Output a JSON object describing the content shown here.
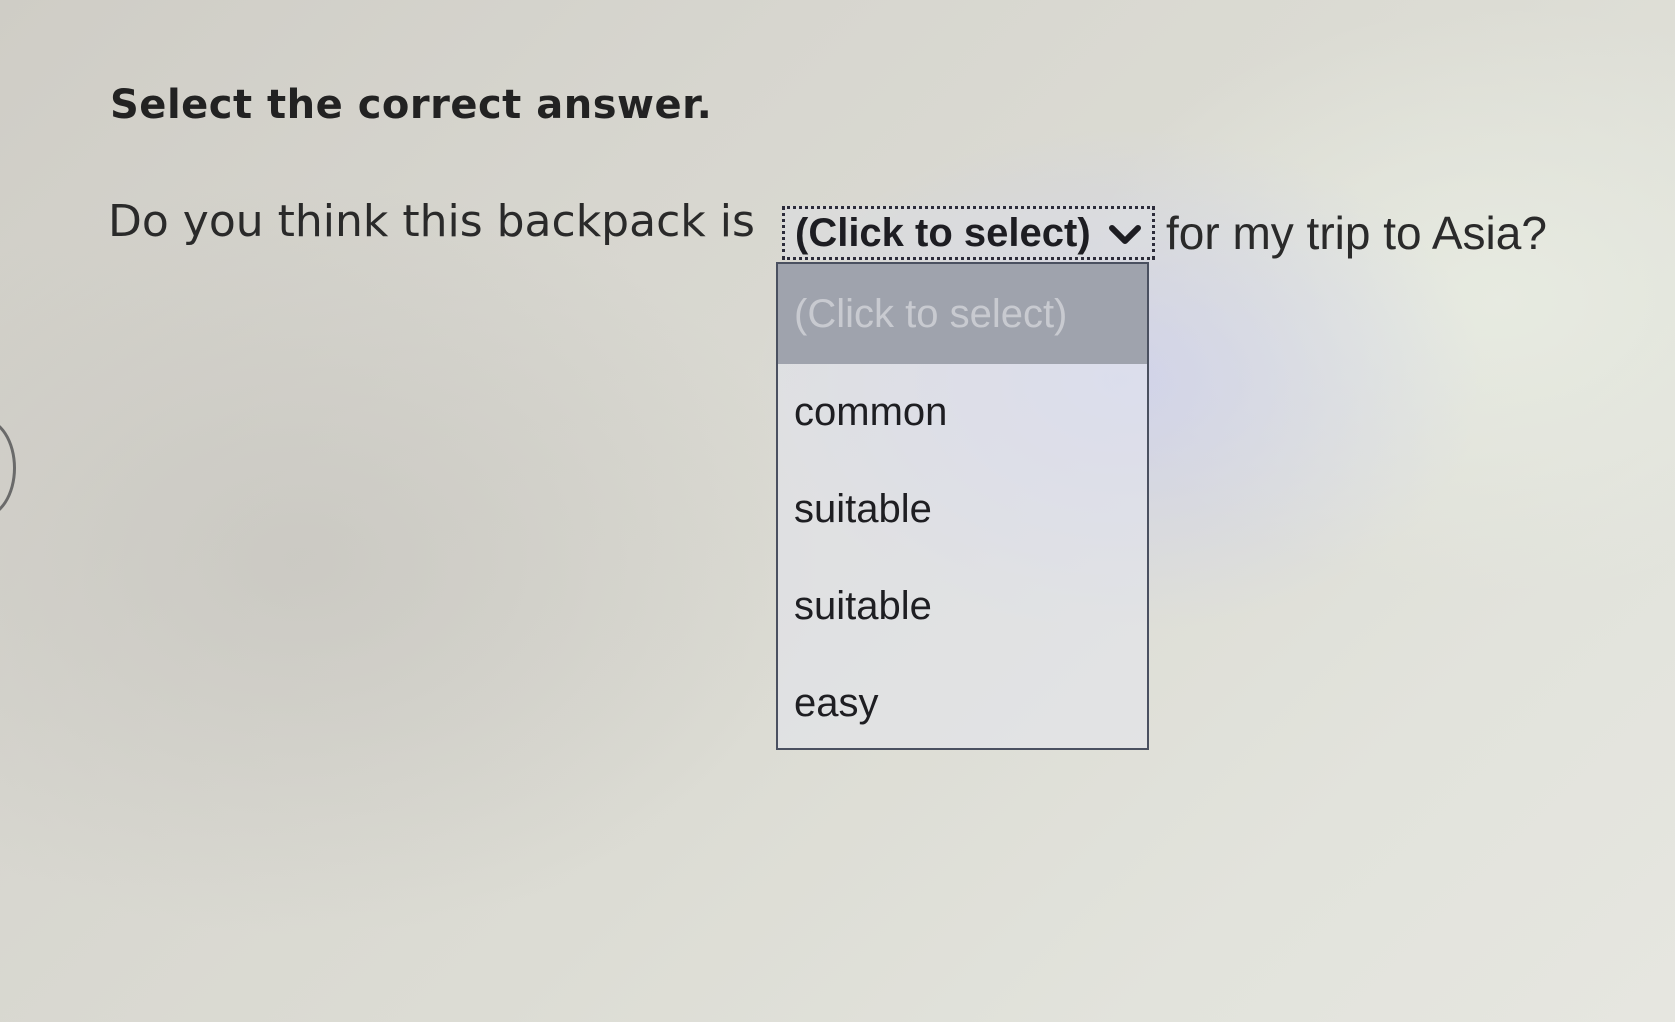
{
  "instruction": "Select the correct answer.",
  "question": {
    "before": "Do you think this backpack is",
    "after": "for my trip to Asia?"
  },
  "select": {
    "selected_label": "(Click to select)",
    "chevron_icon": "chevron-down-icon",
    "options": [
      {
        "label": "(Click to select)",
        "highlighted": true
      },
      {
        "label": "common",
        "highlighted": false
      },
      {
        "label": "suitable",
        "highlighted": false
      },
      {
        "label": "suitable",
        "highlighted": false
      },
      {
        "label": "easy",
        "highlighted": false
      }
    ]
  },
  "colors": {
    "highlight_bg": "#9fa3ad",
    "text": "#1e1e22",
    "border": "#4a5060"
  }
}
